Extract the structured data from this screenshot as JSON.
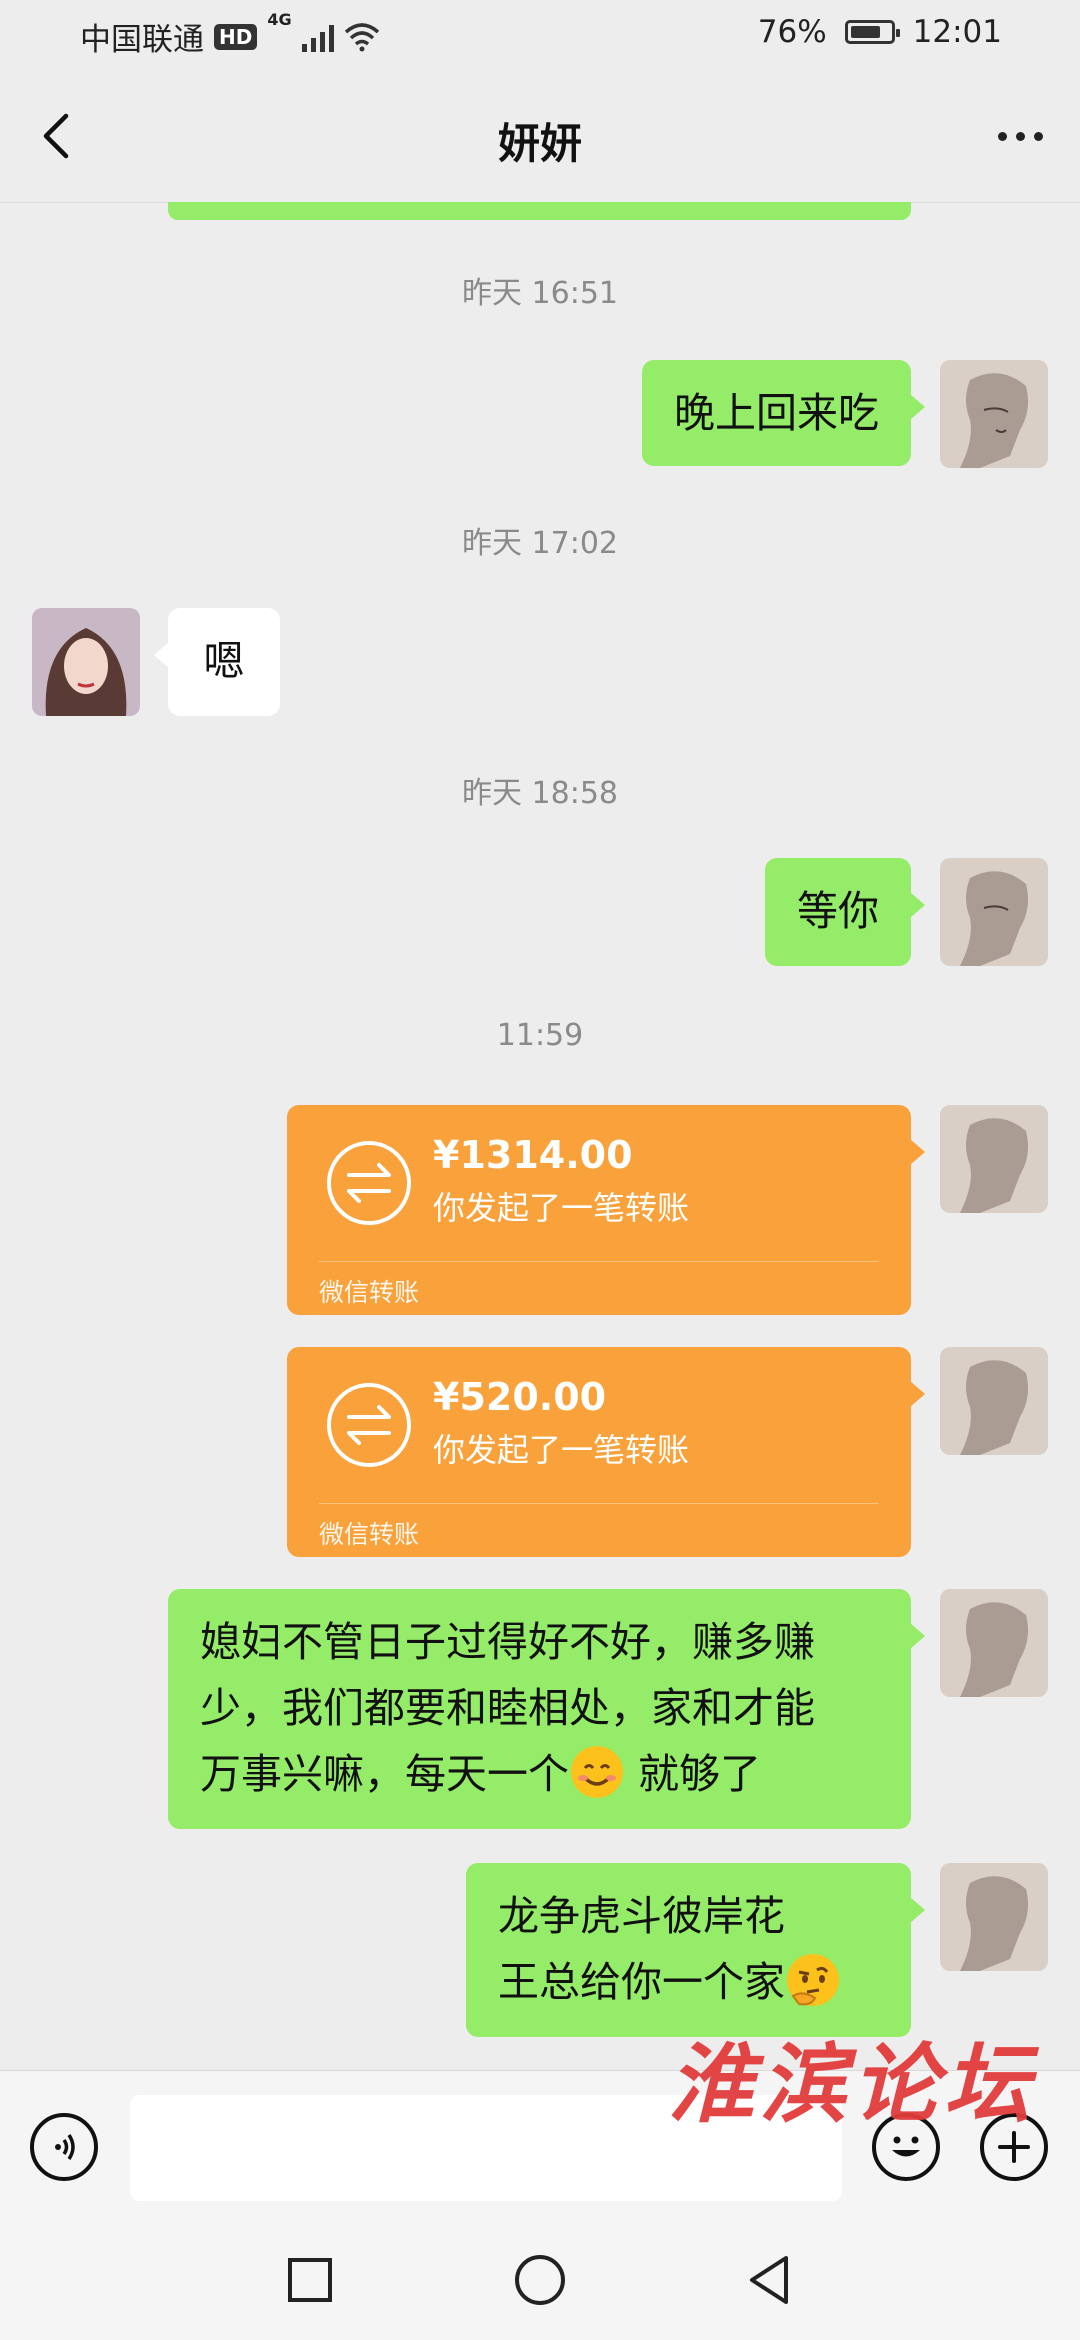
{
  "status_bar": {
    "carrier": "中国联通",
    "hd_badge": "HD",
    "network": "4G",
    "battery_percent": "76%",
    "battery_level": 0.76,
    "time": "12:01"
  },
  "header": {
    "title": "妍妍"
  },
  "messages": [
    {
      "type": "timestamp",
      "text": "昨天 16:51"
    },
    {
      "type": "text",
      "from": "me",
      "text": "晚上回来吃"
    },
    {
      "type": "timestamp",
      "text": "昨天 17:02"
    },
    {
      "type": "text",
      "from": "them",
      "text": "嗯"
    },
    {
      "type": "timestamp",
      "text": "昨天 18:58"
    },
    {
      "type": "text",
      "from": "me",
      "text": "等你"
    },
    {
      "type": "timestamp",
      "text": "11:59"
    },
    {
      "type": "transfer",
      "from": "me",
      "amount": "¥1314.00",
      "description": "你发起了一笔转账",
      "footer": "微信转账"
    },
    {
      "type": "transfer",
      "from": "me",
      "amount": "¥520.00",
      "description": "你发起了一笔转账",
      "footer": "微信转账"
    },
    {
      "type": "text",
      "from": "me",
      "lines": [
        "媳妇不管日子过得好不好，赚多赚",
        "少，我们都要和睦相处，家和才能",
        "万事兴嘛，每天一个"
      ],
      "trailing_emoji": "smiling-face-emoji",
      "tail": " 就够了"
    },
    {
      "type": "text",
      "from": "me",
      "lines": [
        "龙争虎斗彼岸花",
        "王总给你一个家"
      ],
      "trailing_emoji": "thinking-face-emoji"
    }
  ],
  "input": {
    "placeholder": ""
  },
  "watermark": "淮滨论坛",
  "colors": {
    "background": "#ededed",
    "my_bubble": "#95ec69",
    "their_bubble": "#ffffff",
    "transfer_card": "#f9a13a",
    "watermark": "#e23c3c"
  },
  "icons": {
    "back": "chevron-left-icon",
    "more": "more-dots-icon",
    "voice": "voice-icon",
    "emoji": "emoji-icon",
    "plus": "plus-icon",
    "transfer": "transfer-arrows-icon",
    "nav_recent": "square-icon",
    "nav_home": "circle-icon",
    "nav_back": "triangle-back-icon"
  }
}
